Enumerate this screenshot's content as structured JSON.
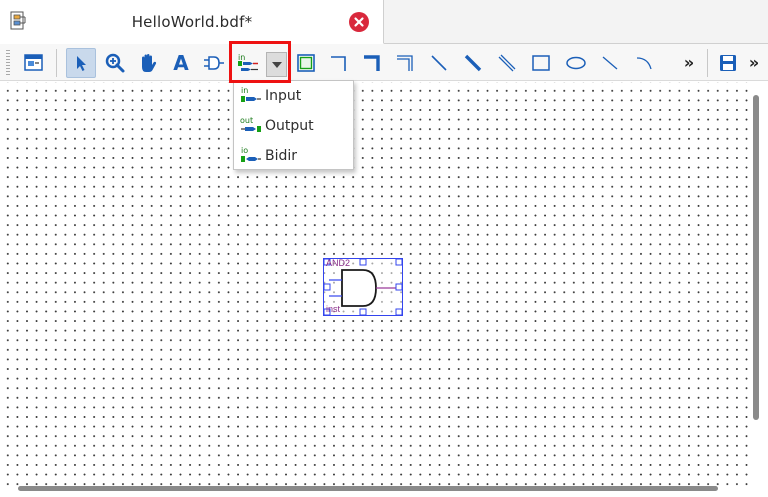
{
  "document_tab": {
    "title": "HelloWorld.bdf*",
    "close_color": "#d9283c"
  },
  "toolbar": {
    "tools": [
      {
        "name": "edit-window",
        "icon": "window-edit-icon"
      },
      {
        "name": "selection-tool",
        "icon": "arrow-pointer-icon",
        "active": true
      },
      {
        "name": "zoom-tool",
        "icon": "magnifier-plus-icon"
      },
      {
        "name": "hand-tool",
        "icon": "hand-icon"
      },
      {
        "name": "text-tool",
        "icon": "text-A-icon",
        "label": "A"
      },
      {
        "name": "symbol-tool",
        "icon": "and-gate-icon"
      },
      {
        "name": "pin-tool",
        "icon": "pin-icon"
      },
      {
        "name": "pin-dropdown",
        "icon": "chevron-down-icon"
      },
      {
        "name": "block-tool",
        "icon": "block-icon"
      },
      {
        "name": "orthogonal-node-tool",
        "icon": "orthogonal-node-icon"
      },
      {
        "name": "orthogonal-bus-tool",
        "icon": "orthogonal-bus-icon"
      },
      {
        "name": "orthogonal-conduit-tool",
        "icon": "orthogonal-conduit-icon"
      },
      {
        "name": "node-tool",
        "icon": "diagonal-line-icon"
      },
      {
        "name": "bus-tool",
        "icon": "diagonal-bus-icon"
      },
      {
        "name": "conduit-tool",
        "icon": "diagonal-conduit-icon"
      },
      {
        "name": "rectangle-tool",
        "icon": "rectangle-icon"
      },
      {
        "name": "oval-tool",
        "icon": "oval-icon"
      },
      {
        "name": "line-tool",
        "icon": "line-icon"
      },
      {
        "name": "arc-tool",
        "icon": "arc-icon"
      },
      {
        "name": "save-tool",
        "icon": "floppy-disk-icon"
      }
    ],
    "overflow_label": "»",
    "overflow_label_2": "»",
    "accent_color": "#1b5fb8",
    "highlight_color": "#ee1111"
  },
  "pin_menu": {
    "items": [
      {
        "icon_text": "in",
        "label": "Input"
      },
      {
        "icon_text": "out",
        "label": "Output"
      },
      {
        "icon_text": "io",
        "label": "Bidir"
      }
    ]
  },
  "canvas": {
    "symbol": {
      "type_label": "AND2",
      "instance_label": "inst",
      "icon": "and-gate-icon",
      "label_color": "#8a2e8a",
      "border_color": "#3344ee"
    }
  }
}
